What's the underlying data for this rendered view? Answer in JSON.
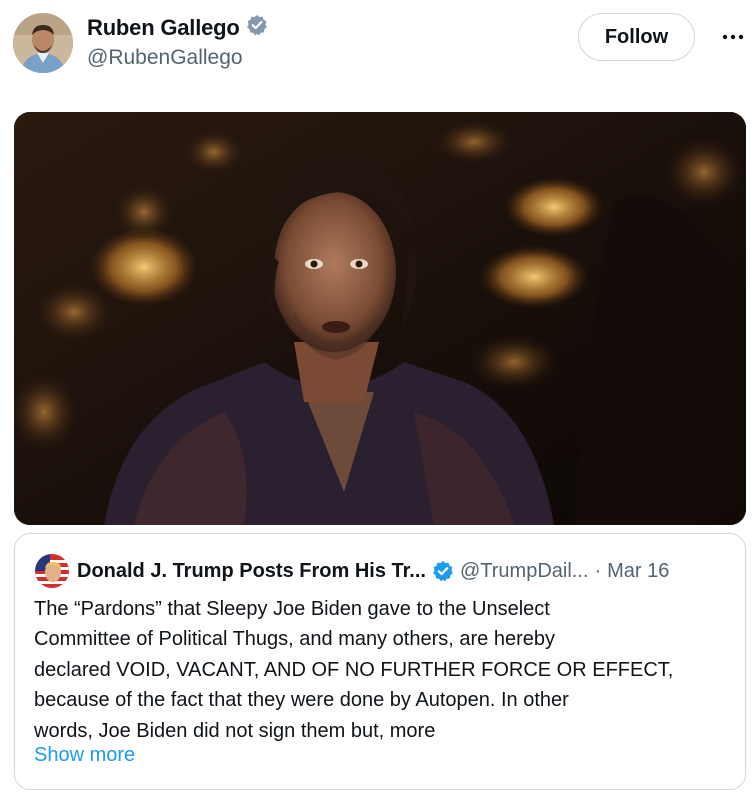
{
  "author": {
    "name": "Ruben Gallego",
    "handle": "@RubenGallego",
    "verified_badge": "verified-badge-gray"
  },
  "actions": {
    "follow_label": "Follow",
    "more_icon": "more-horizontal-icon"
  },
  "media": {
    "kind": "video-still"
  },
  "quoted_post": {
    "name": "Donald J. Trump Posts From His Tr...",
    "handle": "@TrumpDail...",
    "separator": "·",
    "date": "Mar 16",
    "verified_badge": "verified-badge-blue",
    "text_lines": [
      "The “Pardons” that Sleepy Joe Biden gave to the Unselect",
      "Committee of Political Thugs, and many others, are hereby",
      "declared VOID, VACANT, AND OF NO FURTHER FORCE OR EFFECT,",
      "because of the fact that they were done by Autopen. In other",
      "words, Joe Biden did not sign them but, more"
    ],
    "show_more_label": "Show more"
  },
  "colors": {
    "text": "#0f1419",
    "secondary": "#536471",
    "border": "#cfd9de",
    "link": "#1d9bf0",
    "verified_gray": "#829aab",
    "verified_blue": "#1d9bf0"
  }
}
